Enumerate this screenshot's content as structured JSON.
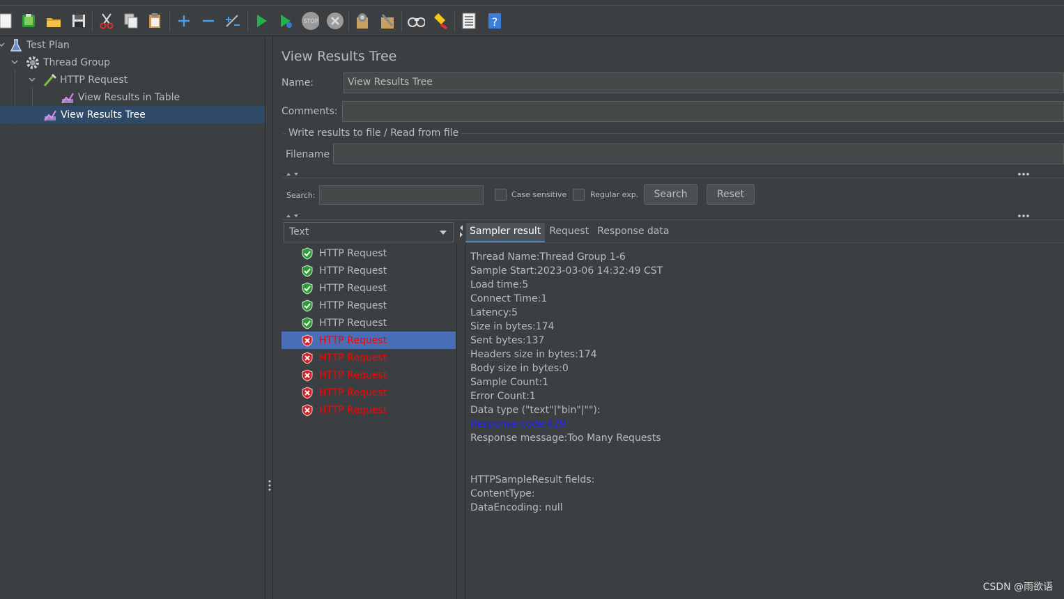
{
  "toolbar": {
    "icons": [
      "new-icon",
      "templates-icon",
      "open-icon",
      "save-icon",
      "cut-icon",
      "copy-icon",
      "paste-icon",
      "expand-icon",
      "collapse-icon",
      "toggle-icon",
      "start-icon",
      "start-no-pause-icon",
      "stop-icon",
      "shutdown-icon",
      "clear-icon",
      "clear-all-icon",
      "search-icon",
      "reset-search-icon",
      "function-helper-icon",
      "help-icon"
    ]
  },
  "tree": {
    "items": [
      {
        "label": "Test Plan"
      },
      {
        "label": "Thread Group"
      },
      {
        "label": "HTTP Request"
      },
      {
        "label": "View Results in Table"
      },
      {
        "label": "View Results Tree",
        "selected": true
      }
    ]
  },
  "panel": {
    "title": "View Results Tree",
    "name_label": "Name:",
    "name_value": "View Results Tree",
    "comments_label": "Comments:",
    "comments_value": "",
    "file_section_label": "Write results to file / Read from file",
    "filename_label": "Filename",
    "filename_value": "",
    "search_label": "Search:",
    "search_value": "",
    "case_sensitive_label": "Case sensitive",
    "regular_exp_label": "Regular exp.",
    "search_button": "Search",
    "reset_button": "Reset",
    "renderer_value": "Text"
  },
  "results": [
    {
      "label": "HTTP Request",
      "status": "ok"
    },
    {
      "label": "HTTP Request",
      "status": "ok"
    },
    {
      "label": "HTTP Request",
      "status": "ok"
    },
    {
      "label": "HTTP Request",
      "status": "ok"
    },
    {
      "label": "HTTP Request",
      "status": "ok"
    },
    {
      "label": "HTTP Request",
      "status": "error",
      "selected": true
    },
    {
      "label": "HTTP Request",
      "status": "error"
    },
    {
      "label": "HTTP Request",
      "status": "error"
    },
    {
      "label": "HTTP Request",
      "status": "error"
    },
    {
      "label": "HTTP Request",
      "status": "error"
    }
  ],
  "tabs": {
    "sampler_result": "Sampler result",
    "request": "Request",
    "response_data": "Response data"
  },
  "detail": {
    "lines": [
      "Thread Name:Thread Group 1-6",
      "Sample Start:2023-03-06 14:32:49 CST",
      "Load time:5",
      "Connect Time:1",
      "Latency:5",
      "Size in bytes:174",
      "Sent bytes:137",
      "Headers size in bytes:174",
      "Body size in bytes:0",
      "Sample Count:1",
      "Error Count:1",
      "Data type (\"text\"|\"bin\"|\"\"):",
      "Response code:429",
      "Response message:Too Many Requests",
      "",
      "",
      "HTTPSampleResult fields:",
      "ContentType:",
      "DataEncoding: null"
    ]
  },
  "watermark": "CSDN @雨欲语",
  "colors": {
    "background": "#3c3f41",
    "selection": "#2f4a68",
    "list_selection": "#4a6eb5",
    "error_text": "#ff0000",
    "response_code": "#1f1fff"
  }
}
